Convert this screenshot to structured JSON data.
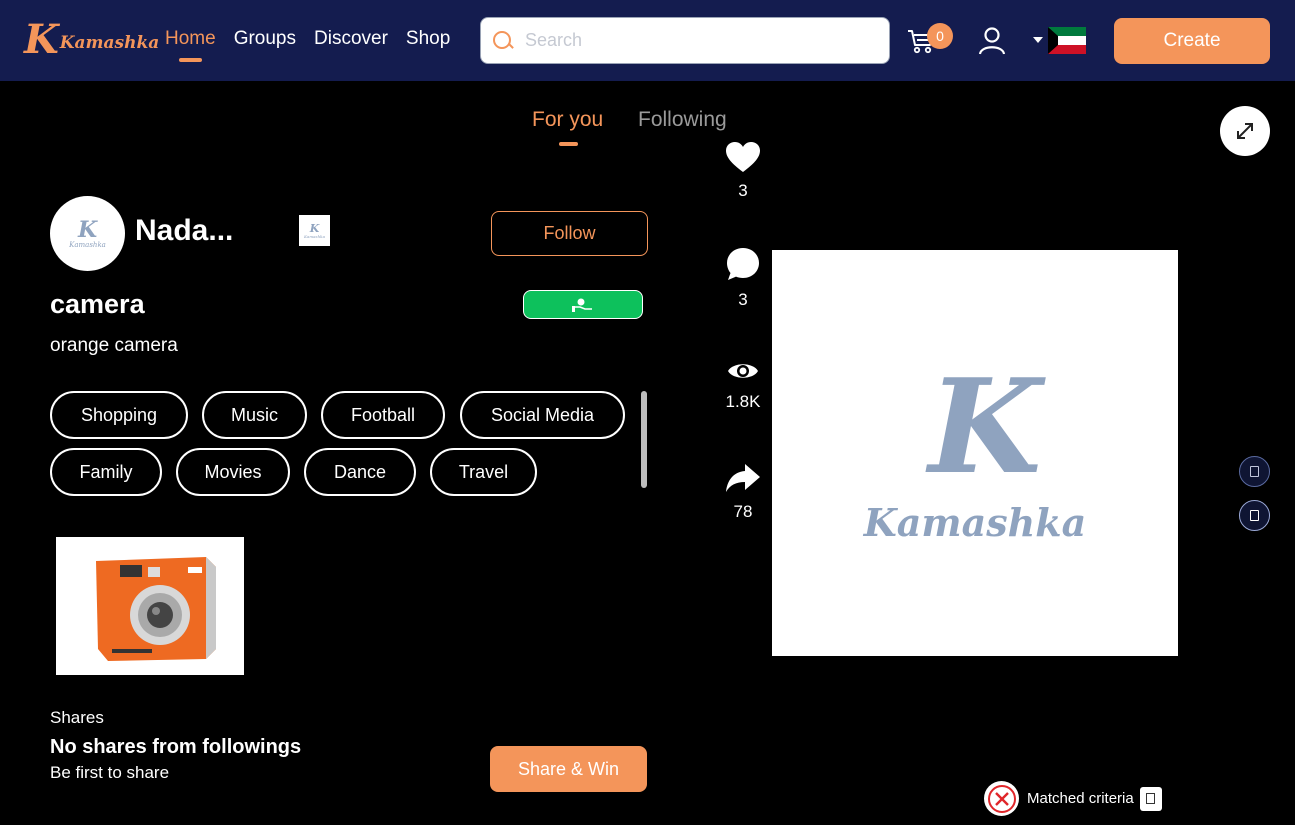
{
  "header": {
    "logo_text": "Kamashka",
    "nav": [
      {
        "label": "Home",
        "active": true
      },
      {
        "label": "Groups",
        "active": false
      },
      {
        "label": "Discover",
        "active": false
      },
      {
        "label": "Shop",
        "active": false
      }
    ],
    "search_placeholder": "Search",
    "cart_count": "0",
    "create_label": "Create",
    "brand_color": "#f4955a",
    "header_bg": "#141c4f"
  },
  "feed_tabs": [
    {
      "label": "For you",
      "active": true
    },
    {
      "label": "Following",
      "active": false
    }
  ],
  "post": {
    "user_name": "Nada...",
    "follow_label": "Follow",
    "title": "camera",
    "description": "orange camera",
    "tags": [
      "Shopping",
      "Music",
      "Football",
      "Social Media",
      "Family",
      "Movies",
      "Dance",
      "Travel"
    ],
    "shares_label": "Shares",
    "no_shares_text": "No shares from followings",
    "be_first_text": "Be first to share",
    "share_win_label": "Share & Win"
  },
  "actions": {
    "likes": "3",
    "comments": "3",
    "views": "1.8K",
    "shares": "78"
  },
  "media": {
    "logo_letter": "K",
    "logo_text": "Kamashka"
  },
  "matched": {
    "label": "Matched criteria"
  }
}
